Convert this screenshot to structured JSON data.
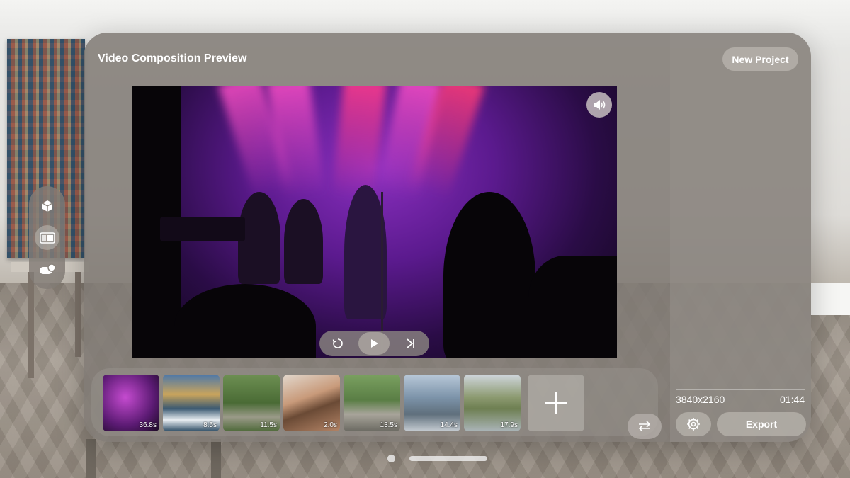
{
  "window": {
    "title": "Video Composition Preview"
  },
  "header": {
    "new_project_label": "New Project"
  },
  "sidebar": {
    "items": [
      {
        "icon": "cube-icon",
        "active": false
      },
      {
        "icon": "timeline-icon",
        "active": true
      },
      {
        "icon": "toggle-badge-icon",
        "active": false
      }
    ]
  },
  "player": {
    "controls": [
      "replay-icon",
      "play-icon",
      "skip-forward-icon"
    ],
    "audio_icon": "speaker-icon"
  },
  "timeline": {
    "clips": [
      {
        "duration": "36.8s"
      },
      {
        "duration": "8.5s"
      },
      {
        "duration": "11.5s"
      },
      {
        "duration": "2.0s"
      },
      {
        "duration": "13.5s"
      },
      {
        "duration": "14.4s"
      },
      {
        "duration": "17.9s"
      }
    ],
    "add_icon": "plus-icon",
    "swap_icon": "swap-arrows-icon"
  },
  "project_info": {
    "resolution": "3840x2160",
    "length": "01:44"
  },
  "actions": {
    "export_label": "Export",
    "settings_icon": "gear-icon"
  },
  "colors": {
    "window": "#807a74",
    "accent_stage": "#8a2fbf"
  }
}
